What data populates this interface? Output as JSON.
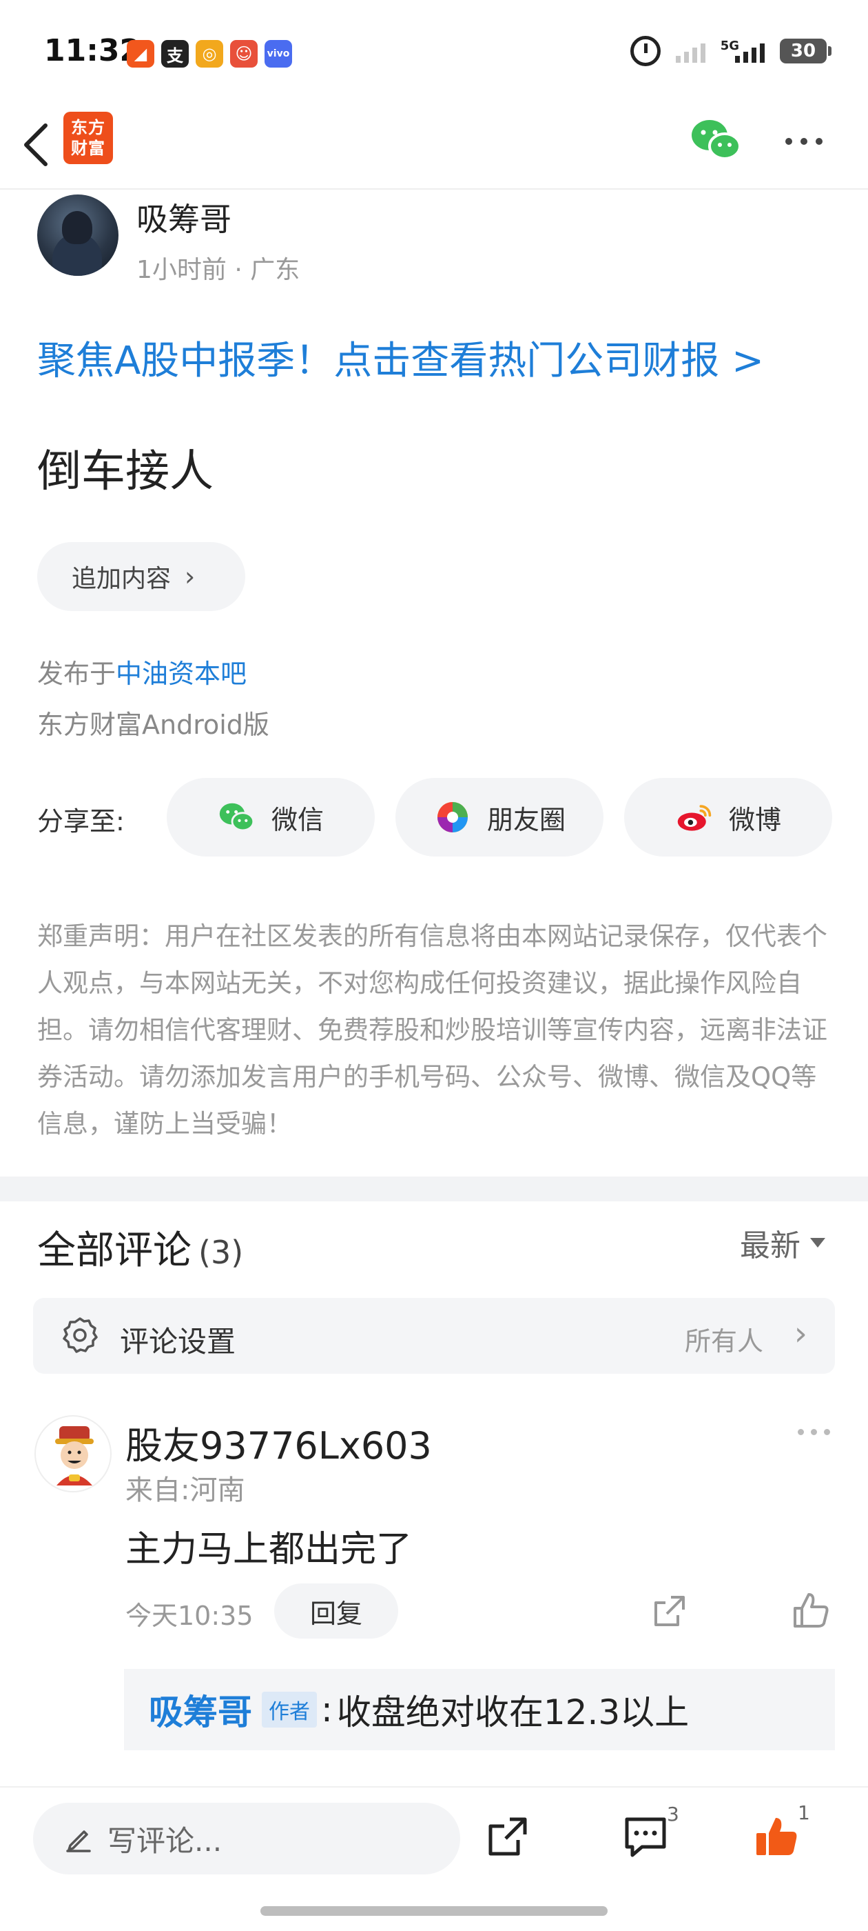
{
  "status_bar": {
    "time": "11:32",
    "network": "5G",
    "battery": "30"
  },
  "header": {
    "brand_line1": "东方",
    "brand_line2": "财富"
  },
  "post": {
    "author": "吸筹哥",
    "meta": "1小时前 · 广东",
    "promo_link": "聚焦A股中报季！点击查看热门公司财报 >",
    "title": "倒车接人",
    "add_content_label": "追加内容",
    "published_prefix": "发布于",
    "published_bar": "中油资本吧",
    "client": "东方财富Android版"
  },
  "share": {
    "label": "分享至:",
    "wechat": "微信",
    "moments": "朋友圈",
    "weibo": "微博"
  },
  "disclaimer": "郑重声明：用户在社区发表的所有信息将由本网站记录保存，仅代表个人观点，与本网站无关，不对您构成任何投资建议，据此操作风险自担。请勿相信代客理财、免费荐股和炒股培训等宣传内容，远离非法证券活动。请勿添加发言用户的手机号码、公众号、微博、微信及QQ等信息，谨防上当受骗！",
  "comments": {
    "title": "全部评论",
    "count": "(3)",
    "sort": "最新",
    "settings_label": "评论设置",
    "settings_value": "所有人",
    "items": [
      {
        "user": "股友93776Lx603",
        "region": "来自:河南",
        "text": "主力马上都出完了",
        "time": "今天10:35",
        "reply_label": "回复",
        "reply": {
          "author": "吸筹哥",
          "tag": "作者",
          "colon": ":",
          "text": "收盘绝对收在12.3以上"
        }
      }
    ]
  },
  "bottom_bar": {
    "placeholder": "写评论...",
    "comment_count": "3",
    "like_count": "1"
  },
  "colors": {
    "accent_blue": "#1e7ed8",
    "brand_orange": "#ee4e1b",
    "like_orange": "#f25a16"
  }
}
